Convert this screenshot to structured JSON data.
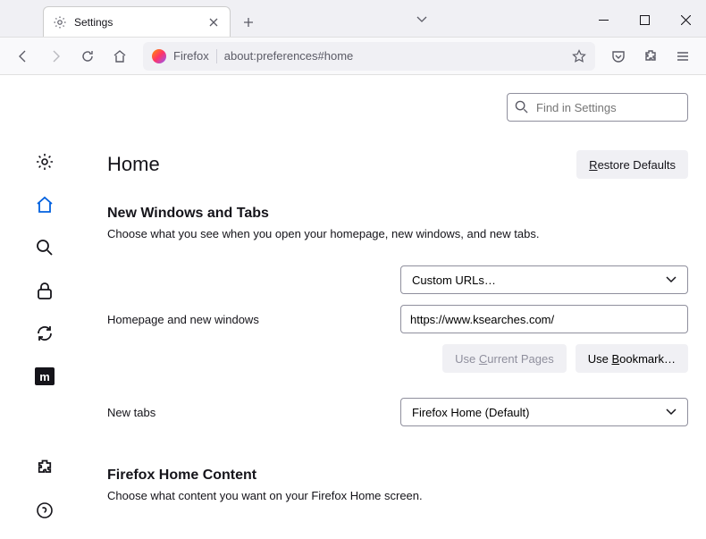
{
  "titlebar": {
    "tab_title": "Settings"
  },
  "toolbar": {
    "brand": "Firefox",
    "url": "about:preferences#home"
  },
  "search": {
    "placeholder": "Find in Settings"
  },
  "header": {
    "title": "Home",
    "restore": "estore Defaults"
  },
  "section1": {
    "title": "New Windows and Tabs",
    "desc": "Choose what you see when you open your homepage, new windows, and new tabs."
  },
  "homepage": {
    "label": "Homepage and new windows",
    "dropdown": "Custom URLs…",
    "input": "https://www.ksearches.com/",
    "use_current": "urrent Pages",
    "use_bookmark": "ookmark…"
  },
  "newtabs": {
    "label": "New tabs",
    "dropdown": "Firefox Home (Default)"
  },
  "section2": {
    "title": "Firefox Home Content",
    "desc": "Choose what content you want on your Firefox Home screen."
  },
  "sidebar": {
    "m": "m"
  }
}
